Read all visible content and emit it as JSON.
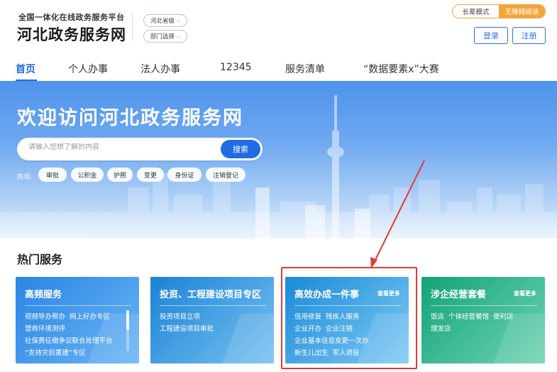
{
  "header": {
    "subtitle": "全国一体化在线政务服务平台",
    "title": "河北政务服务网",
    "region_select": "河北省级",
    "dept_select": "部门选择",
    "mode_elder": "长辈模式",
    "mode_barrier_free": "无障碍阅读",
    "login_label": "登录",
    "register_label": "注册"
  },
  "nav": {
    "items": [
      "首页",
      "个人办事",
      "法人办事",
      "12345",
      "服务清单",
      "“数据要素x”大赛"
    ]
  },
  "banner": {
    "title": "欢迎访问河北政务服务网",
    "search_placeholder": "请输入您想了解的内容",
    "search_button": "搜索",
    "hot_label": "热词:",
    "hot_tags": [
      "审批",
      "公积金",
      "护照",
      "变更",
      "身份证",
      "注销登记"
    ]
  },
  "section": {
    "title": "热门服务"
  },
  "cards": [
    {
      "title": "高频服务",
      "more": "",
      "rows": [
        [
          "视频导办帮办",
          "网上好办专区"
        ],
        [
          "营商环境测评"
        ],
        [
          "社保费征缴争议联合处理平台"
        ],
        [
          "“支持灾后重建”专区"
        ]
      ]
    },
    {
      "title": "投资、工程建设项目专区",
      "more": "",
      "rows": [
        [
          "投资项目立项"
        ],
        [
          "工程建设项目审批"
        ]
      ]
    },
    {
      "title": "高效办成一件事",
      "more": "查看更多",
      "rows": [
        [
          "信用修复",
          "残疾人服务"
        ],
        [
          "企业开办",
          "企业注销"
        ],
        [
          "企业基本信息变更一次办"
        ],
        [
          "新生儿出生",
          "军人退役"
        ]
      ]
    },
    {
      "title": "涉企经营套餐",
      "more": "查看更多",
      "rows": [
        [
          "饭店",
          "个体经营餐馆",
          "便利店"
        ],
        [
          "理发店"
        ]
      ]
    }
  ],
  "colors": {
    "primary": "#1f6ce6",
    "accent_orange": "#f4a53a",
    "highlight_red": "#e23b32"
  }
}
